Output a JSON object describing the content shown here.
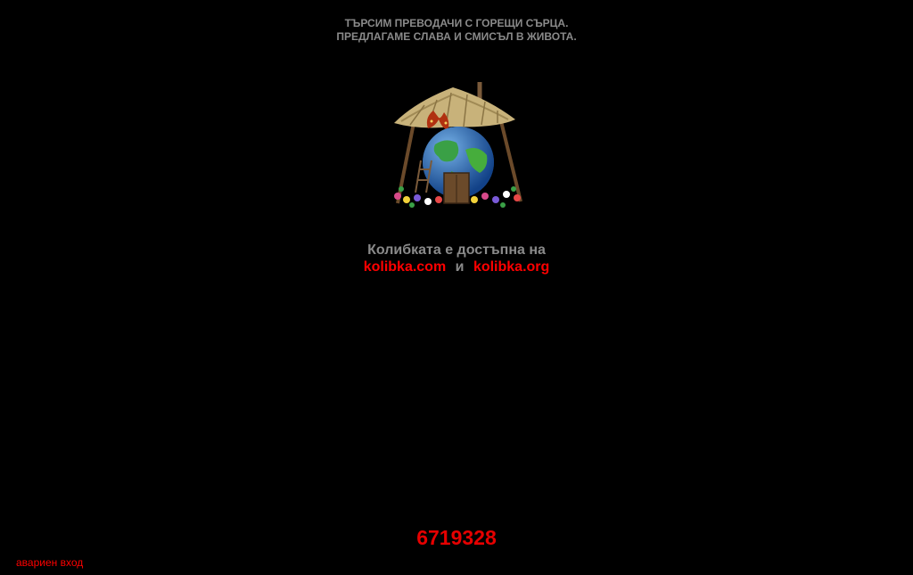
{
  "banner": {
    "line1": "ТЪРСИМ ПРЕВОДАЧИ С ГОРЕЩИ СЪРЦА.",
    "line2": "ПРЕДЛАГАМЕ СЛАВА И СМИСЪЛ В ЖИВОТА."
  },
  "logo": {
    "icon": "hut-globe-logo"
  },
  "availability": {
    "lead": "Колибката е достъпна на",
    "link1": "kolibka.com",
    "conjunction": "и",
    "link2": "kolibka.org"
  },
  "counter": {
    "value": "6719328"
  },
  "footer": {
    "emergency_link": "авариен вход"
  },
  "colors": {
    "background": "#000000",
    "text_gray": "#8a8a8a",
    "link_red": "#ff0000"
  }
}
